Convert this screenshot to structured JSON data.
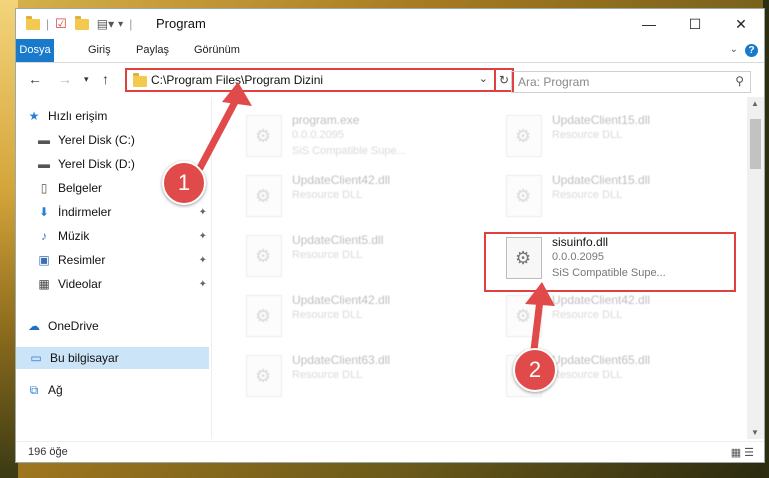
{
  "titlebar": {
    "title": "Program",
    "minimize": "—",
    "maximize": "☐",
    "close": "✕"
  },
  "ribbon": {
    "tabs": [
      "Dosya",
      "Giriş",
      "Paylaş",
      "Görünüm"
    ],
    "help": "?",
    "expand": "⌄"
  },
  "address": {
    "path": "C:\\Program Files\\Program Dizini",
    "search_placeholder": "Ara: Program"
  },
  "sidebar": {
    "items": [
      {
        "label": "Hızlı erişim",
        "icon": "star-icon"
      },
      {
        "label": "Yerel Disk (C:)",
        "icon": "drive-icon"
      },
      {
        "label": "Yerel Disk (D:)",
        "icon": "drive-icon"
      },
      {
        "label": "Belgeler",
        "icon": "document-icon"
      },
      {
        "label": "İndirmeler",
        "icon": "download-icon"
      },
      {
        "label": "Müzik",
        "icon": "music-icon"
      },
      {
        "label": "Resimler",
        "icon": "pictures-icon"
      },
      {
        "label": "Videolar",
        "icon": "video-icon"
      },
      {
        "label": "OneDrive",
        "icon": "cloud-icon"
      },
      {
        "label": "Bu bilgisayar",
        "icon": "computer-icon"
      },
      {
        "label": "Ağ",
        "icon": "network-icon"
      }
    ]
  },
  "files": {
    "left": [
      {
        "name": "program.exe",
        "line1": "0.0.0.2095",
        "line2": "SiS Compatible Supe..."
      },
      {
        "name": "UpdateClient42.dll",
        "line1": "Resource DLL",
        "line2": ""
      },
      {
        "name": "UpdateClient5.dll",
        "line1": "Resource DLL",
        "line2": ""
      },
      {
        "name": "UpdateClient42.dll",
        "line1": "Resource DLL",
        "line2": ""
      },
      {
        "name": "UpdateClient63.dll",
        "line1": "Resource DLL",
        "line2": ""
      }
    ],
    "right": [
      {
        "name": "UpdateClient15.dll",
        "line1": "Resource DLL",
        "line2": ""
      },
      {
        "name": "UpdateClient15.dll",
        "line1": "Resource DLL",
        "line2": ""
      },
      {
        "name": "sisuinfo.dll",
        "line1": "0.0.0.2095",
        "line2": "SiS Compatible Supe..."
      },
      {
        "name": "UpdateClient42.dll",
        "line1": "Resource DLL",
        "line2": ""
      },
      {
        "name": "UpdateClient65.dll",
        "line1": "Resource DLL",
        "line2": ""
      }
    ]
  },
  "status": {
    "count": "196 öğe"
  },
  "annotations": {
    "badge1": "1",
    "badge2": "2"
  },
  "colors": {
    "accent": "#1979ca",
    "highlight": "#e04040"
  }
}
